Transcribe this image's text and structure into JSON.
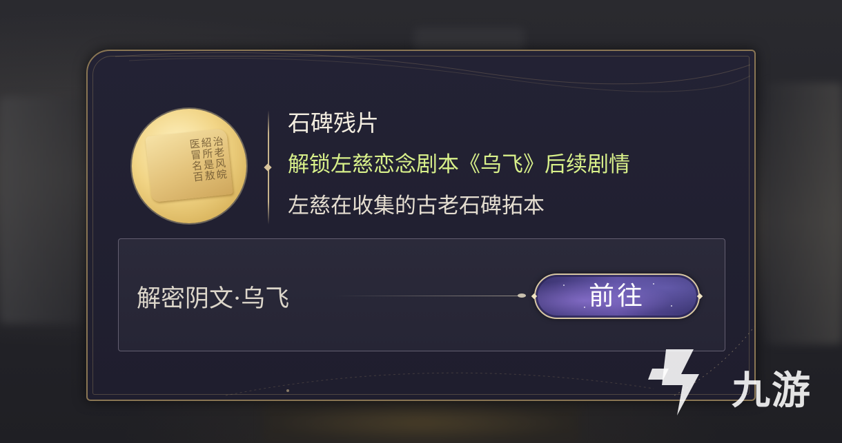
{
  "item": {
    "name": "石碑残片",
    "unlock_text": "解锁左慈恋念剧本《乌飞》后续剧情",
    "description": "左慈在收集的古老石碑拓本",
    "icon": "stone-tablet-rubbing-icon",
    "icon_glyphs": "治老风皖紹所是敖医冒名百"
  },
  "quest": {
    "label": "解密阴文·乌飞",
    "go_label": "前往"
  },
  "watermark": {
    "text": "九游"
  },
  "colors": {
    "unlock_text": "#d8f08a",
    "panel_border": "#8a7654",
    "panel_bg": "#232234",
    "button_bg": "#4a3f88"
  }
}
